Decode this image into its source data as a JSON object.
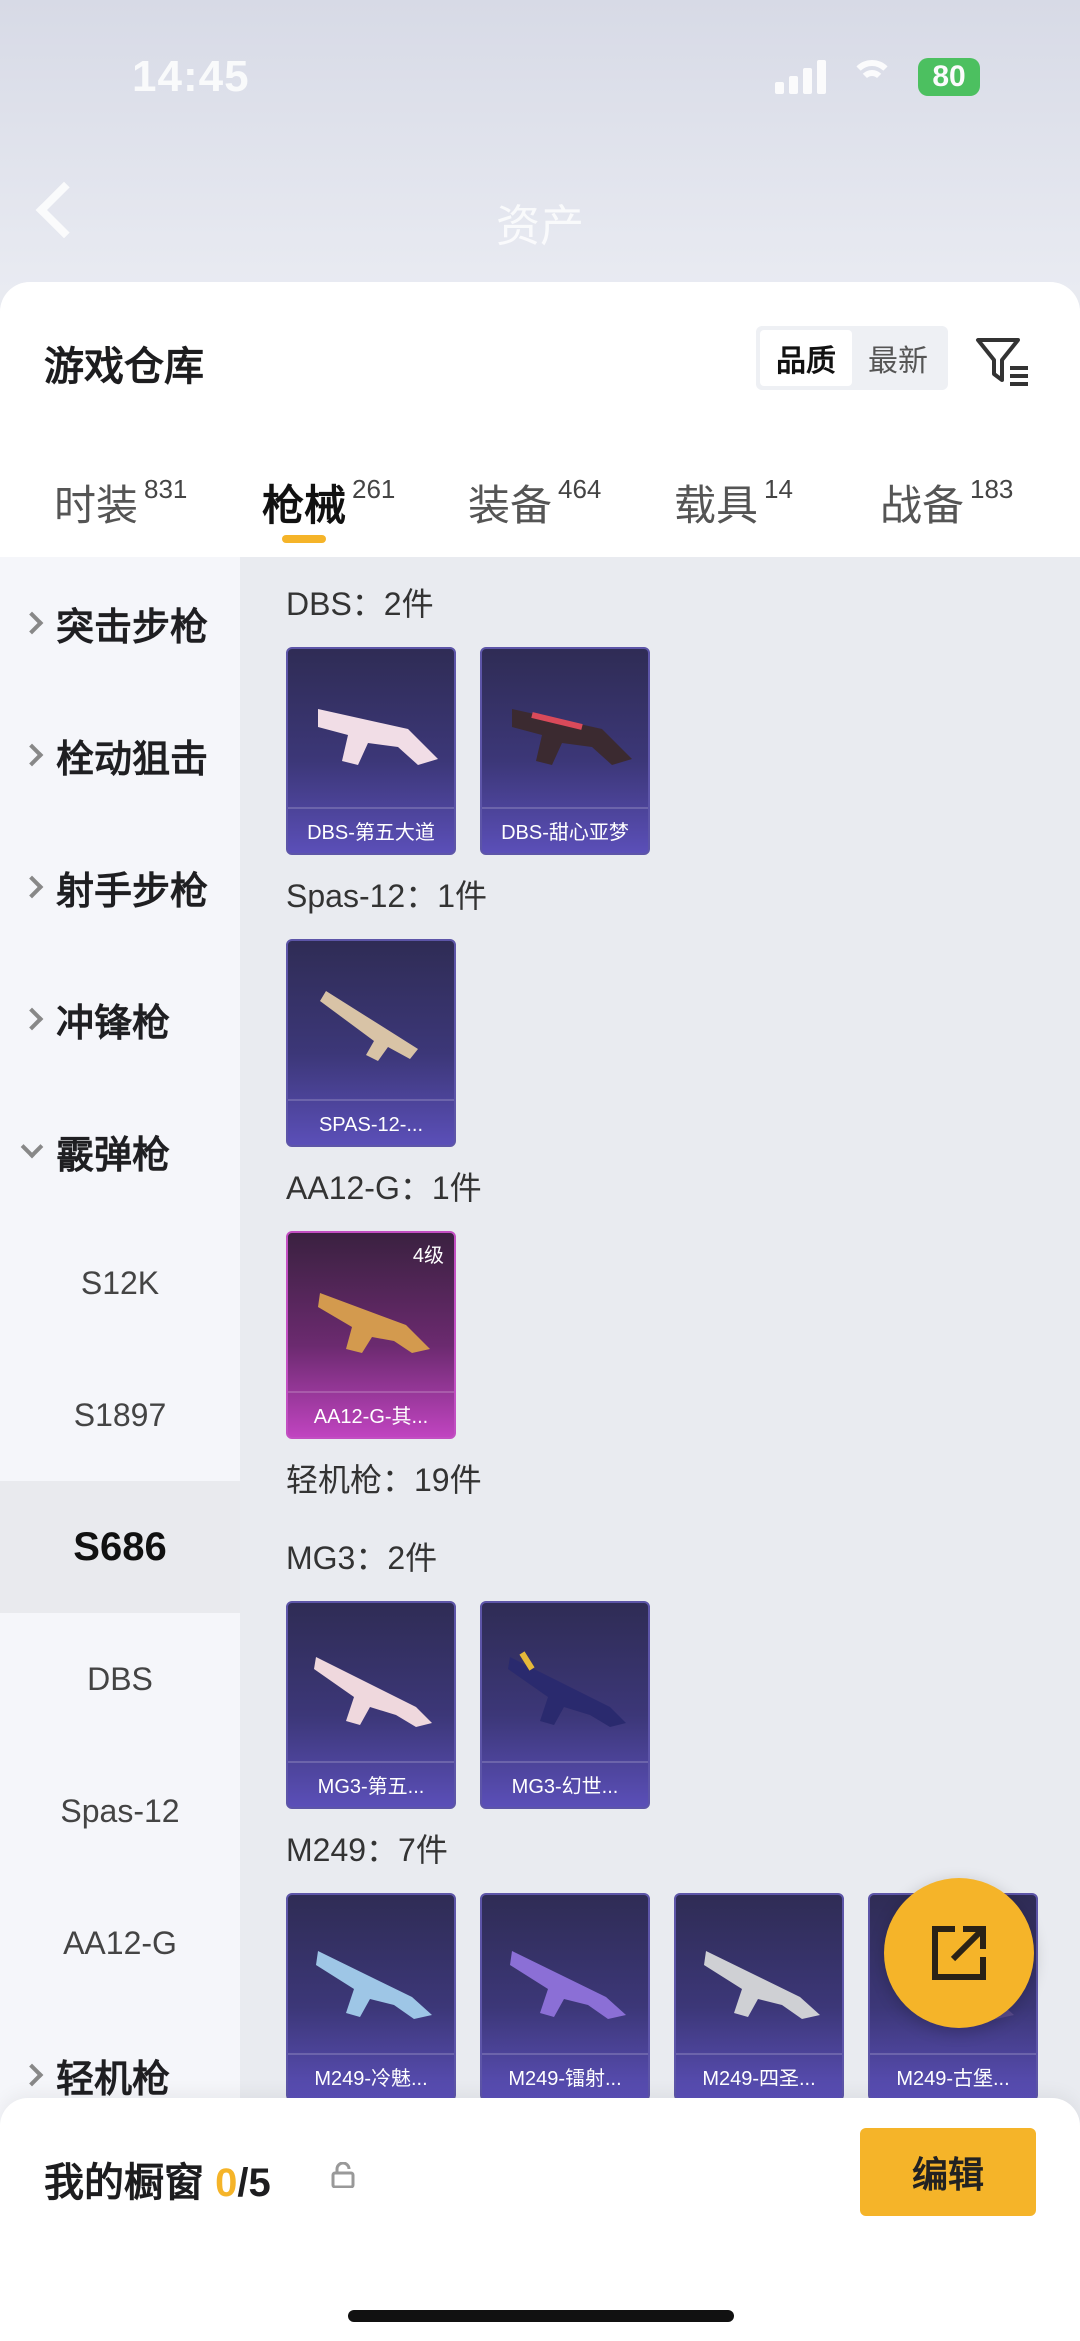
{
  "status": {
    "time": "14:45",
    "battery": "80"
  },
  "nav": {
    "title": "资产"
  },
  "header": {
    "title": "游戏仓库",
    "sort_quality": "品质",
    "sort_newest": "最新"
  },
  "tabs": [
    {
      "label": "时装",
      "count": "831"
    },
    {
      "label": "枪械",
      "count": "261"
    },
    {
      "label": "装备",
      "count": "464"
    },
    {
      "label": "载具",
      "count": "14"
    },
    {
      "label": "战备",
      "count": "183"
    }
  ],
  "sidebar": {
    "categories": [
      "突击步枪",
      "栓动狙击",
      "射手步枪",
      "冲锋枪",
      "霰弹枪",
      "轻机枪"
    ],
    "sub": [
      "S12K",
      "S1897",
      "S686",
      "DBS",
      "Spas-12",
      "AA12-G"
    ]
  },
  "groups": [
    {
      "label": "DBS：2件",
      "items": [
        "DBS-第五大道",
        "DBS-甜心亚梦"
      ]
    },
    {
      "label": "Spas-12：1件",
      "items": [
        "SPAS-12-..."
      ]
    },
    {
      "label": "AA12-G：1件",
      "items": [
        "AA12-G-其..."
      ],
      "level": "4级"
    },
    {
      "label": "轻机枪：19件"
    },
    {
      "label": "MG3：2件",
      "items": [
        "MG3-第五...",
        "MG3-幻世..."
      ]
    },
    {
      "label": "M249：7件",
      "items": [
        "M249-冷魅...",
        "M249-镭射...",
        "M249-四圣...",
        "M249-古堡..."
      ]
    }
  ],
  "bottom": {
    "label": "我的橱窗",
    "current": "0",
    "max": "/5",
    "edit": "编辑"
  },
  "colors": {
    "accent": "#f5b429",
    "card_blue": "#3c3778",
    "card_purple": "#c044c0"
  }
}
